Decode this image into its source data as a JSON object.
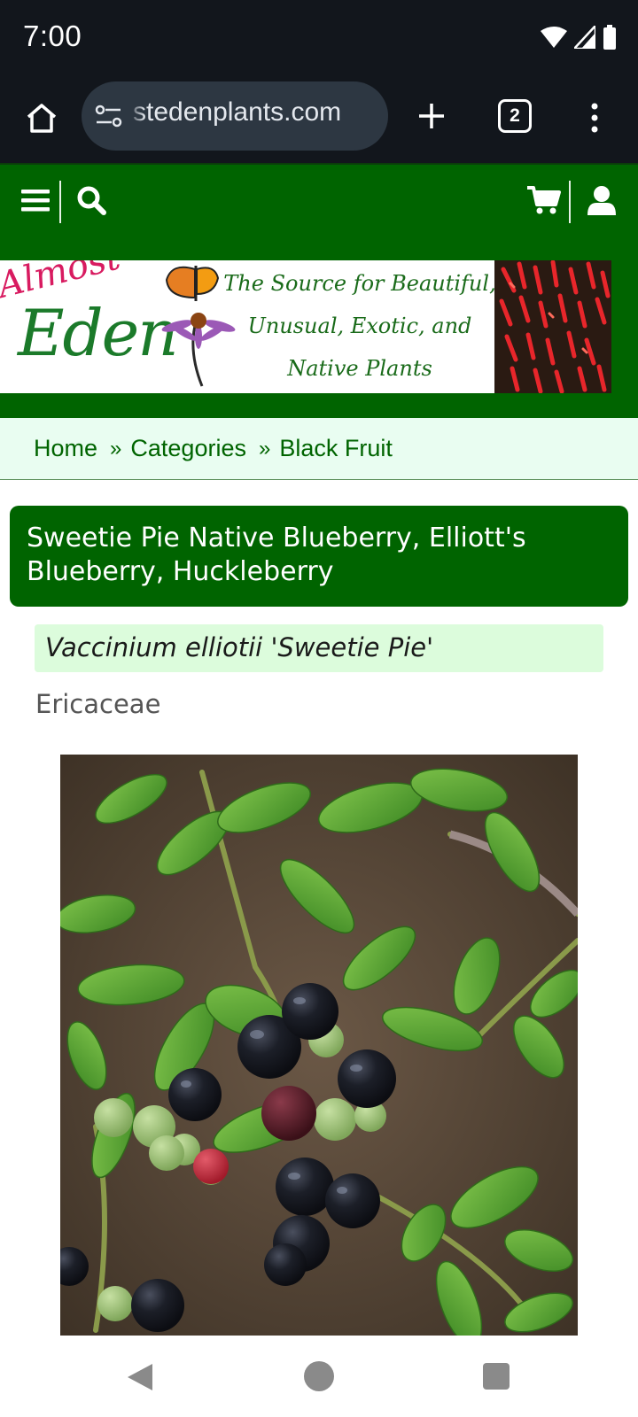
{
  "status_bar": {
    "time": "7:00",
    "icons": [
      "wifi-icon",
      "cellular-signal-icon",
      "battery-icon"
    ]
  },
  "browser": {
    "url": "stedenplants.com",
    "tab_count": "2",
    "buttons": [
      "home-icon",
      "site-info-icon",
      "new-tab-icon",
      "tab-switcher",
      "overflow-menu-icon"
    ]
  },
  "site_nav": {
    "icons": [
      "hamburger-menu-icon",
      "search-icon",
      "shopping-cart-icon",
      "user-account-icon"
    ]
  },
  "banner": {
    "logo_almost": "Almost",
    "logo_eden": "Eden",
    "tagline_line1": "The Source for Beautiful,",
    "tagline_line2": "Unusual, Exotic, and",
    "tagline_line3": "Native Plants"
  },
  "breadcrumb": {
    "items": [
      "Home",
      "Categories",
      "Black Fruit"
    ],
    "separator": "»"
  },
  "product": {
    "title": "Sweetie Pie Native Blueberry, Elliott's Blueberry, Huckleberry",
    "botanical_name": "Vaccinium elliotii 'Sweetie Pie'",
    "family": "Ericaceae"
  },
  "colors": {
    "site_green": "#006400",
    "breadcrumb_bg": "#e9fdf1",
    "botanical_bg": "#dcfcdc",
    "browser_bg": "#12161c"
  },
  "android_nav": [
    "back-icon",
    "home-circle-icon",
    "recents-square-icon"
  ]
}
